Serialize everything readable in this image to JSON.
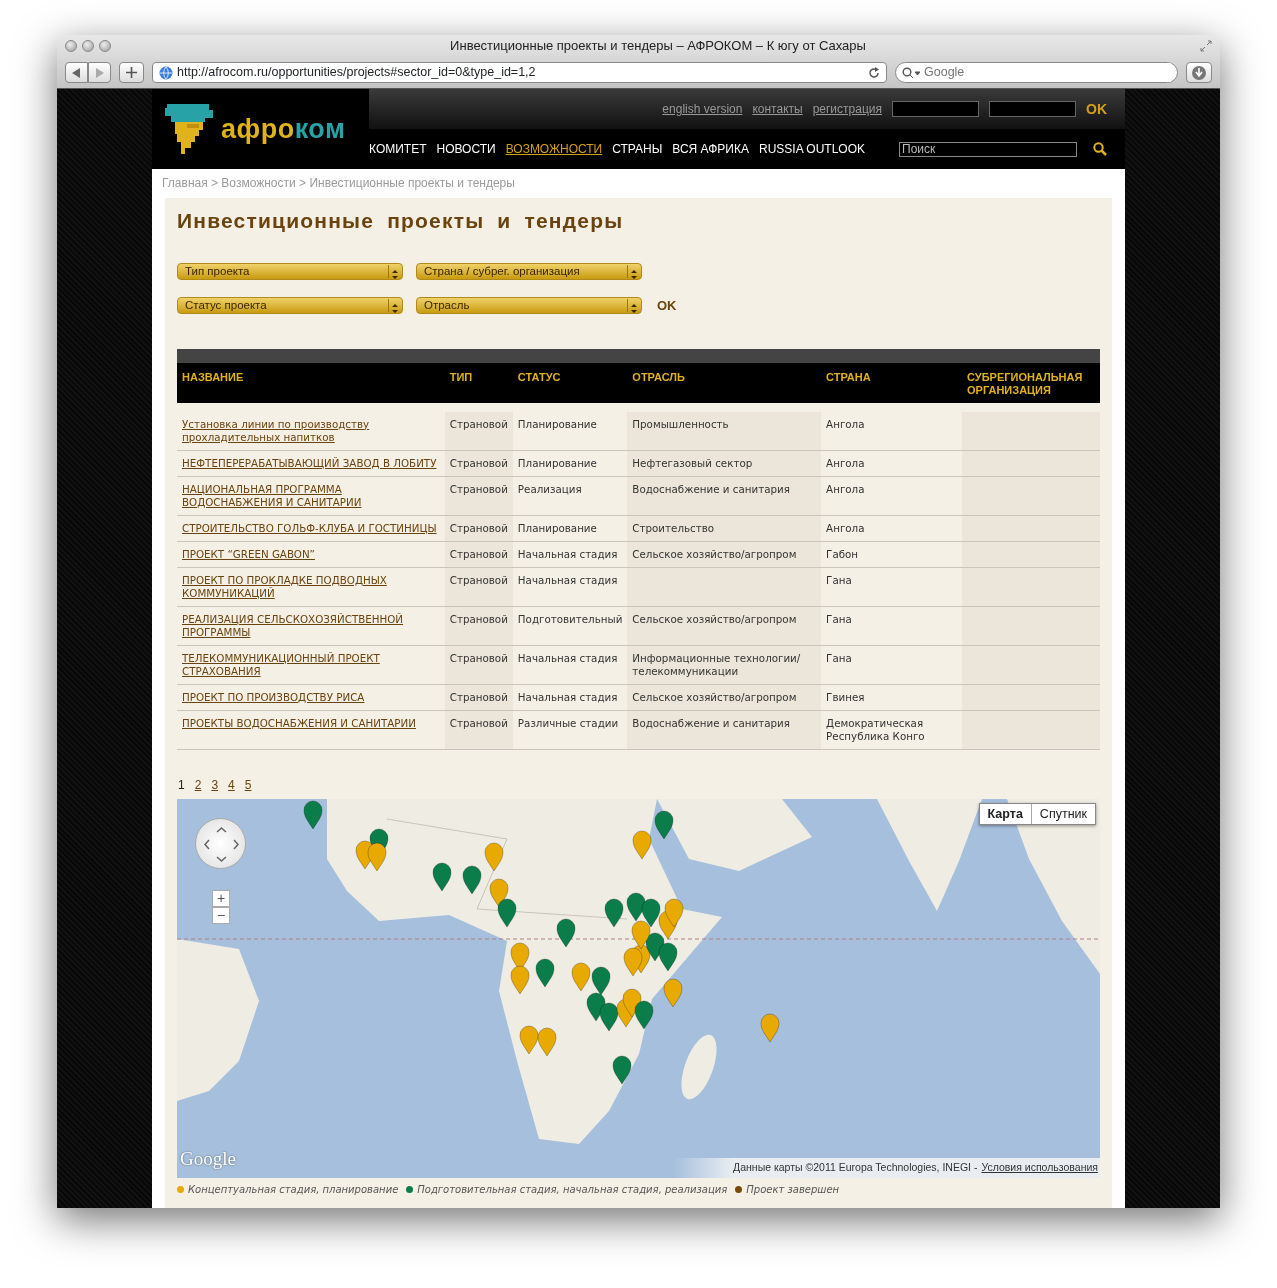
{
  "window": {
    "title": "Инвестиционные проекты и тендеры – АФРОКОМ – К югу от Сахары"
  },
  "address_bar": {
    "url": "http://afrocom.ru/opportunities/projects#sector_id=0&type_id=1,2"
  },
  "browser_search": {
    "placeholder": "Google"
  },
  "logo": {
    "part_1": "афро",
    "part_2": "ком"
  },
  "top_links": [
    "english version",
    "контакты",
    "регистрация"
  ],
  "login": {
    "button": "OK"
  },
  "nav": [
    {
      "label": "КОМИТЕТ",
      "selected": false
    },
    {
      "label": "НОВОСТИ",
      "selected": false
    },
    {
      "label": "ВОЗМОЖНОСТИ",
      "selected": true
    },
    {
      "label": "СТРАНЫ",
      "selected": false
    },
    {
      "label": "ВСЯ АФРИКА",
      "selected": false
    },
    {
      "label": "RUSSIA OUTLOOK",
      "selected": false
    }
  ],
  "site_search": {
    "placeholder": "Поиск"
  },
  "breadcrumb": "Главная > Возможности > Инвестиционные проекты и тендеры",
  "page_title": "Инвестиционные проекты и тендеры",
  "filters": [
    "Тип проекта",
    "Страна / субрег. организация",
    "Статус проекта",
    "Отрасль"
  ],
  "filter_button": "OK",
  "table": {
    "columns": [
      "НАЗВАНИЕ",
      "ТИП",
      "СТАТУС",
      "ОТРАСЛЬ",
      "СТРАНА",
      "СУБРЕГИОНАЛЬНАЯ ОРГАНИЗАЦИЯ"
    ],
    "rows": [
      {
        "name": "Установка линии по производству прохладительных напитков",
        "type": "Страновой",
        "status": "Планирование",
        "sector": "Промышленность",
        "country": "Ангола"
      },
      {
        "name": "НЕФТЕПЕРЕРАБАТЫВАЮЩИЙ ЗАВОД В ЛОБИТУ",
        "type": "Страновой",
        "status": "Планирование",
        "sector": "Нефтегазовый сектор",
        "country": "Ангола"
      },
      {
        "name": "НАЦИОНАЛЬНАЯ ПРОГРАММА ВОДОСНАБЖЕНИЯ И САНИТАРИИ",
        "type": "Страновой",
        "status": "Реализация",
        "sector": "Водоснабжение и санитария",
        "country": "Ангола"
      },
      {
        "name": "СТРОИТЕЛЬСТВО ГОЛЬФ-КЛУБА И ГОСТИНИЦЫ",
        "type": "Страновой",
        "status": "Планирование",
        "sector": "Строительство",
        "country": "Ангола"
      },
      {
        "name": "ПРОЕКТ “GREEN GABON”",
        "type": "Страновой",
        "status": "Начальная стадия",
        "sector": "Сельское хозяйство/агропром",
        "country": "Габон"
      },
      {
        "name": "ПРОЕКТ ПО ПРОКЛАДКЕ ПОДВОДНЫХ КОММУНИКАЦИЙ",
        "type": "Страновой",
        "status": "Начальная стадия",
        "country": "Гана"
      },
      {
        "name": "РЕАЛИЗАЦИЯ СЕЛЬСКОХОЗЯЙСТВЕННОЙ ПРОГРАММЫ",
        "type": "Страновой",
        "status": "Подготовительный",
        "sector": "Сельское хозяйство/агропром",
        "country": "Гана"
      },
      {
        "name": "ТЕЛЕКОММУНИКАЦИОННЫЙ ПРОЕКТ СТРАХОВАНИЯ",
        "type": "Страновой",
        "status": "Начальная стадия",
        "sector": "Информационные технологии/ телекоммуникации",
        "country": "Гана"
      },
      {
        "name": "ПРОЕКТ ПО ПРОИЗВОДСТВУ РИСА",
        "type": "Страновой",
        "status": "Начальная стадия",
        "sector": "Сельское хозяйство/агропром",
        "country": "Гвинея"
      },
      {
        "name": "ПРОЕКТЫ ВОДОСНАБЖЕНИЯ И САНИТАРИИ",
        "type": "Страновой",
        "status": "Различные стадии",
        "sector": "Водоснабжение и санитария",
        "country": "Демократическая Республика Конго"
      }
    ]
  },
  "pagination": [
    {
      "label": "1",
      "selected": true
    },
    {
      "label": "2",
      "selected": false
    },
    {
      "label": "3",
      "selected": false
    },
    {
      "label": "4",
      "selected": false
    },
    {
      "label": "5",
      "selected": false
    }
  ],
  "map": {
    "kind": "picture",
    "zoom_in": "+",
    "zoom_out": "−",
    "map_types": [
      {
        "label": "Карта",
        "selected": true
      },
      {
        "label": "Спутник",
        "selected": false
      }
    ],
    "logo": "Google",
    "attribution": "Данные карты ©2011 Europa Technologies, INEGI -",
    "terms_link": "Условия использования"
  },
  "legend": [
    {
      "label": "Концептуальная стадия, планирование",
      "color": "#e8aa00"
    },
    {
      "label": "Подготовительная стадия, начальная стадия, реализация",
      "color": "#0b7d4b"
    },
    {
      "label": "Проект завершен",
      "color": "#7a4a06"
    }
  ]
}
